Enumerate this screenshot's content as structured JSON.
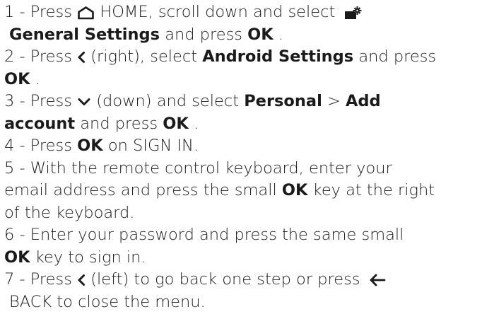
{
  "steps": [
    {
      "num": "1 - ",
      "a1": "Press ",
      "a2": " HOME, scroll down and select ",
      "a3": "General Settings",
      "a4": " and press ",
      "a5": "OK",
      "a6": "."
    },
    {
      "num": "2 - ",
      "a1": "Press ",
      "a2": " (right), select ",
      "a3": "Android Settings",
      "a4": " and press",
      "a5": "OK",
      "a6": "."
    },
    {
      "num": "3 - ",
      "a1": "Press ",
      "a2": " (down) and select ",
      "a3": "Personal",
      "a4": " > ",
      "a5": "Add",
      "a6": "account",
      "a7": " and press ",
      "a8": "OK",
      "a9": "."
    },
    {
      "num": "4 - ",
      "a1": "Press ",
      "a2": "OK",
      "a3": " on SIGN IN."
    },
    {
      "num": "5 - ",
      "a1": "With the remote control keyboard, enter your",
      "a2": "email address and press the small ",
      "a3": "OK",
      "a4": " key at the right",
      "a5": "of the keyboard."
    },
    {
      "num": "6 - ",
      "a1": "Enter your password and press the same small",
      "a2": "OK",
      "a3": " key to sign in."
    },
    {
      "num": "7 - ",
      "a1": "Press ",
      "a2": " (left) to go back one step or press ",
      "a3": "BACK to close the menu."
    }
  ],
  "icons": {
    "home": "home-icon",
    "settings": "settings-icon",
    "chevron_left": "chevron-left-icon",
    "chevron_down": "chevron-down-icon",
    "back_arrow": "back-arrow-icon"
  }
}
